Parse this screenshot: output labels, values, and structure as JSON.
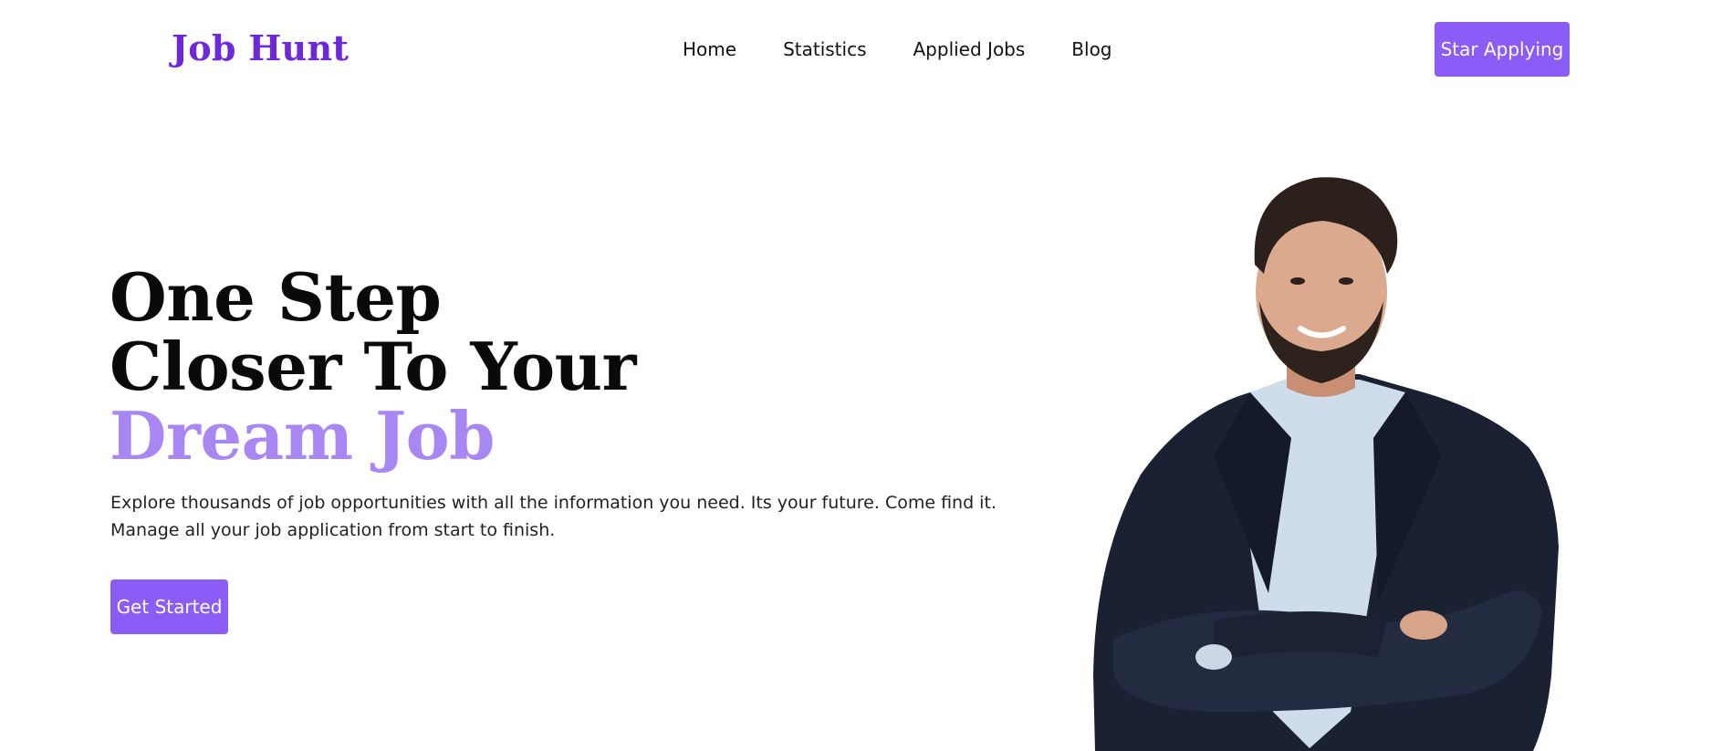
{
  "header": {
    "logo": "Job Hunt",
    "nav": [
      "Home",
      "Statistics",
      "Applied Jobs",
      "Blog"
    ],
    "cta_label": "Star Applying"
  },
  "hero": {
    "title_lines": [
      "One Step",
      "Closer To Your"
    ],
    "title_accent": "Dream Job",
    "subtitle_lines": [
      "Explore thousands of job opportunities with all the information you need. Its your future. Come find it.",
      "Manage all your job application from start to finish."
    ],
    "cta_label": "Get Started"
  },
  "colors": {
    "brand": "#6d28d9",
    "button": "#8b5cf6",
    "accent_text": "#a886f3"
  },
  "image": {
    "subject": "smiling-man-with-crossed-arms"
  }
}
